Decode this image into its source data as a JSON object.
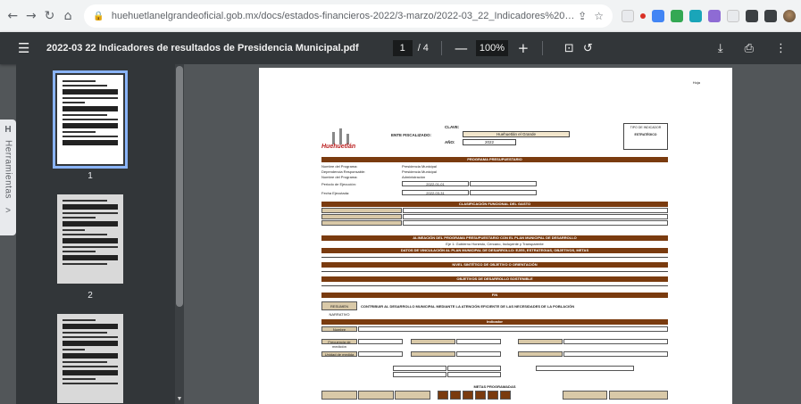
{
  "browser": {
    "url": "huehuetlanelgrandeoficial.gob.mx/docs/estados-financieros-2022/3-marzo/2022-03_22_Indicadores%20de%20resultado...",
    "icons": [
      "back-arrow-icon",
      "forward-arrow-icon",
      "reload-icon",
      "home-icon",
      "lock-icon",
      "share-icon",
      "star-icon"
    ]
  },
  "pdf_toolbar": {
    "title": "2022-03 22 Indicadores de resultados de Presidencia Municipal.pdf",
    "current_page": "1",
    "page_total": "/ 4",
    "zoom": "100%",
    "minus": "—",
    "plus": "+"
  },
  "side_tab": {
    "letter": "H",
    "label": "Herramientas",
    "chevron": ">"
  },
  "thumbnails": [
    {
      "number": "1",
      "selected": true
    },
    {
      "number": "2",
      "selected": false
    },
    {
      "number": "3",
      "selected": false
    }
  ],
  "document": {
    "corner": "Hoja",
    "clave_label": "CLAVE:",
    "clave_value": "Huehuetlán el Grande",
    "ente_label": "ENTE FISCALIZADO:",
    "anio_label": "AÑO:",
    "anio_value": "2022",
    "tipo_label": "TIPO DE INDICADOR",
    "tipo_value": "ESTRATÉGICO",
    "logo_text": "Huehuetlán",
    "band_programa": "PROGRAMA PRESUPUESTARIO",
    "programa_rows": [
      {
        "label": "Nombre del Programa:",
        "value": "Presidencia Municipal"
      },
      {
        "label": "Dependencia Responsable:",
        "value": "Presidencia Municipal"
      },
      {
        "label": "Nombre del Programa:",
        "value": "Administración"
      },
      {
        "label": "Periodo de Ejecución:",
        "value": "2022-01-01"
      },
      {
        "label": "Fecha Ejecutada:",
        "value": "2022-03-31"
      }
    ],
    "band_clasificacion": "CLASIFICACIÓN FUNCIONAL DEL GASTO",
    "band_alineacion": "ALINEACIÓN DEL PROGRAMA PRESUPUESTARIO CON EL PLAN MUNICIPAL DE DESARROLLO",
    "eje_text": "Eje 1: Gobierno Honesto, Cercano, Incluyente y Transparente",
    "band_objetivos": "DATOS DE VINCULACIÓN AL PLAN MUNICIPAL DE DESARROLLO: EJES, ESTRATEGIAS, OBJETIVOS, METAS",
    "band_nivel": "NIVEL SINTÉTICO DE OBJETIVO O ORIENTACIÓN",
    "band_ods": "OBJETIVOS DE DESARROLLO SOSTENIBLE",
    "band_fin": "FIN",
    "band_indicador": "Indicador",
    "fin_label": "RESUMEN NARRATIVO",
    "fin_text": "CONTRIBUIR AL DESARROLLO MUNICIPAL MEDIANTE LA ATENCIÓN EFICIENTE DE LAS NECESIDADES DE LA POBLACIÓN",
    "ind_rows": [
      "Nombre",
      "Frecuencia de medición",
      "Unidad de medida"
    ],
    "band_metas": "METAS PROGRAMADAS"
  }
}
